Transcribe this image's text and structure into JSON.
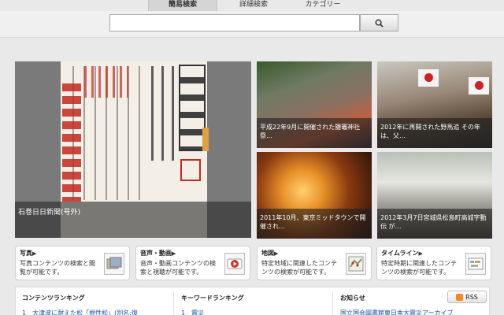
{
  "tabs": [
    {
      "label": "簡易検索",
      "active": true
    },
    {
      "label": "詳細検索",
      "active": false
    },
    {
      "label": "カテゴリー",
      "active": false
    }
  ],
  "search": {
    "value": "",
    "placeholder": "",
    "button_icon": "search-icon"
  },
  "feature": {
    "caption": "石巻日日新聞(号外)"
  },
  "thumbnails": [
    {
      "caption": "平成22年9月に開催された鹽竈神社祭…"
    },
    {
      "caption": "2012年に再開された野馬追 その年は、父…"
    },
    {
      "caption": "2011年10月、東京ミッドタウンで開催され…"
    },
    {
      "caption": "2012年3月7日宮城県松島町高城字動伝 が…"
    }
  ],
  "cards": [
    {
      "title": "写真",
      "desc": "写真コンテンツの検索と閲覧が可能です。",
      "icon": "photo-icon"
    },
    {
      "title": "音声・動画",
      "desc": "音声・動画コンテンツの検索と視聴が可能です。",
      "icon": "video-icon"
    },
    {
      "title": "地図",
      "desc": "特定地域に関連したコンテンツの検索が可能です。",
      "icon": "map-icon"
    },
    {
      "title": "タイムライン",
      "desc": "特定時期に関連したコンテンツの検索が可能です。",
      "icon": "timeline-icon"
    }
  ],
  "bottom": {
    "ranking_title": "コンテンツランキング",
    "ranking_item": "1　大津波に耐えた松「根性松」(別名:復",
    "keyword_title": "キーワードランキング",
    "keyword_item": "1　震災",
    "news_title": "お知らせ",
    "news_item": "国立国会図書館東日本大震災アーカイブ",
    "rss_label": "RSS"
  }
}
